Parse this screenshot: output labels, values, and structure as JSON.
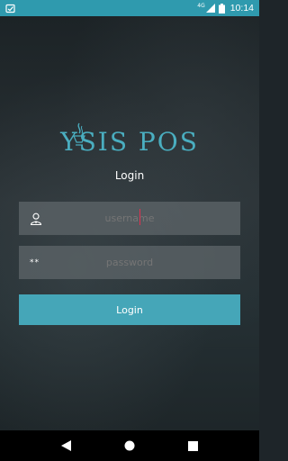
{
  "status_bar": {
    "network_label": "4G",
    "time": "10:14",
    "background_color": "#2f9aae",
    "icons": [
      "notification-icon",
      "signal-icon",
      "battery-icon"
    ]
  },
  "logo": {
    "text": "YSIS POS",
    "color": "#4aaec0"
  },
  "login_form": {
    "title": "Login",
    "username": {
      "placeholder": "username"
    },
    "password": {
      "placeholder": "password",
      "icon_text": "**"
    },
    "submit_label": "Login",
    "button_color": "#45a6b8"
  },
  "nav_bar": {
    "icons": [
      "back-icon",
      "home-icon",
      "recents-icon"
    ]
  }
}
